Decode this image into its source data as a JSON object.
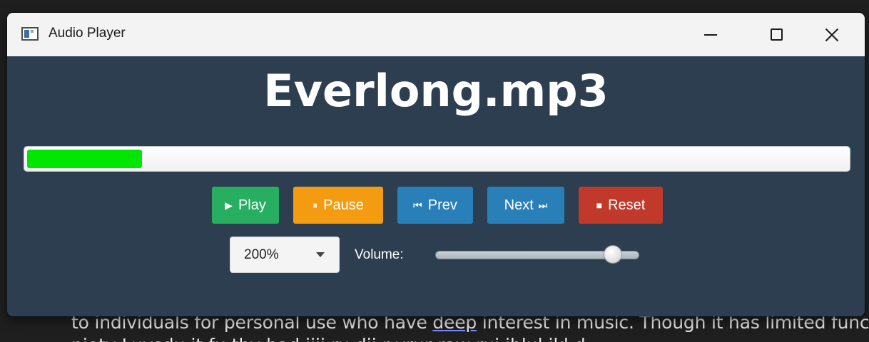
{
  "window": {
    "title": "Audio Player"
  },
  "player": {
    "track_title": "Everlong.mp3",
    "progress_fraction": 0.14,
    "buttons": {
      "play": {
        "label": "Play",
        "icon": "play-icon",
        "glyph": "▶",
        "color": "#27ae60"
      },
      "pause": {
        "label": "Pause",
        "icon": "pause-icon",
        "glyph": "⏸",
        "color": "#f39c12"
      },
      "prev": {
        "label": "Prev",
        "icon": "skip-back-icon",
        "glyph": "⏮",
        "color": "#2980b9"
      },
      "next": {
        "label": "Next",
        "icon": "skip-forward-icon",
        "glyph": "⏭",
        "color": "#2980b9"
      },
      "reset": {
        "label": "Reset",
        "icon": "stop-icon",
        "glyph": "■",
        "color": "#c0392b"
      }
    },
    "speed": {
      "selected": "200%"
    },
    "volume": {
      "label": "Volume:",
      "level_fraction": 0.87
    },
    "progress_color": "#00e600",
    "background_color": "#2c3e50"
  },
  "background_page": {
    "line1_before": "to individuals for personal use who have ",
    "line1_link": "deep",
    "line1_after": " interest in music. Though it has limited func",
    "line2": "nioty Luvsdu it fu thy bad iiii ru dii r yrur raw rui iblul jkl d"
  }
}
